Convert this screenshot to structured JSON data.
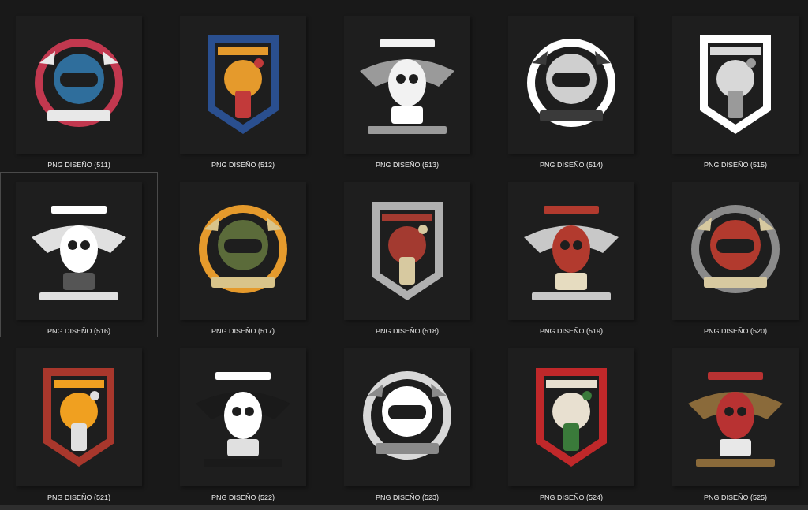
{
  "files": [
    {
      "label": "PNG DISEÑO (511)",
      "selected": false
    },
    {
      "label": "PNG DISEÑO (512)",
      "selected": false
    },
    {
      "label": "PNG DISEÑO (513)",
      "selected": false
    },
    {
      "label": "PNG DISEÑO (514)",
      "selected": false
    },
    {
      "label": "PNG DISEÑO (515)",
      "selected": false
    },
    {
      "label": "PNG DISEÑO (516)",
      "selected": true
    },
    {
      "label": "PNG DISEÑO (517)",
      "selected": false
    },
    {
      "label": "PNG DISEÑO (518)",
      "selected": false
    },
    {
      "label": "PNG DISEÑO (519)",
      "selected": false
    },
    {
      "label": "PNG DISEÑO (520)",
      "selected": false
    },
    {
      "label": "PNG DISEÑO (521)",
      "selected": false
    },
    {
      "label": "PNG DISEÑO (522)",
      "selected": false
    },
    {
      "label": "PNG DISEÑO (523)",
      "selected": false
    },
    {
      "label": "PNG DISEÑO (524)",
      "selected": false
    },
    {
      "label": "PNG DISEÑO (525)",
      "selected": false
    }
  ]
}
